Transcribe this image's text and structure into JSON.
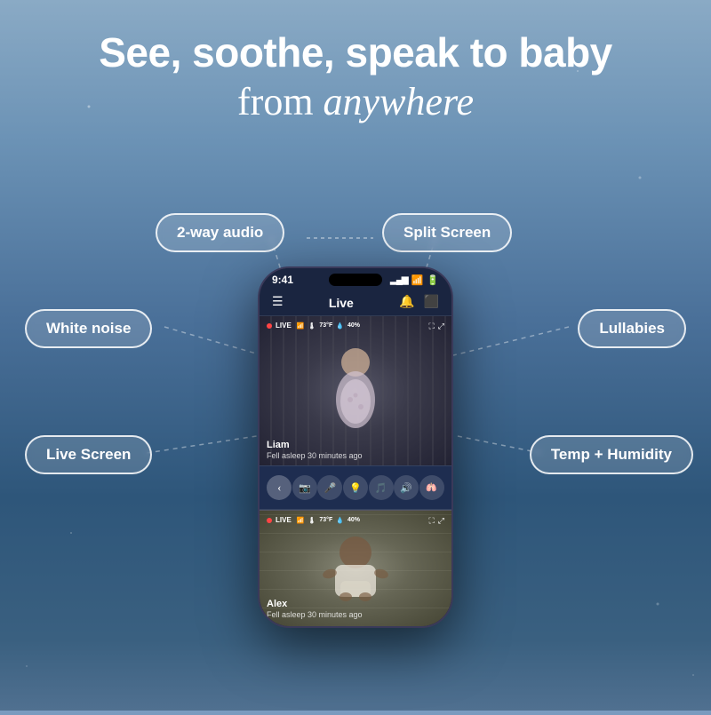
{
  "headline": {
    "line1": "See, soothe, speak to baby",
    "line2_prefix": "from ",
    "line2_italic": "anywhere"
  },
  "features": {
    "audio": "2-way audio",
    "split": "Split Screen",
    "whitenoise": "White noise",
    "lullabies": "Lullabies",
    "livescreen": "Live Screen",
    "temp": "Temp + Humidity"
  },
  "phone": {
    "status_time": "9:41",
    "nav_title": "Live",
    "feeds": [
      {
        "live_label": "LIVE",
        "temp": "73°F",
        "humidity": "40%",
        "baby_name": "Liam",
        "baby_status": "Fell asleep 30 minutes ago"
      },
      {
        "live_label": "LIVE",
        "temp": "73°F",
        "humidity": "40%",
        "baby_name": "Alex",
        "baby_status": "Fell asleep 30 minutes ago"
      }
    ]
  }
}
